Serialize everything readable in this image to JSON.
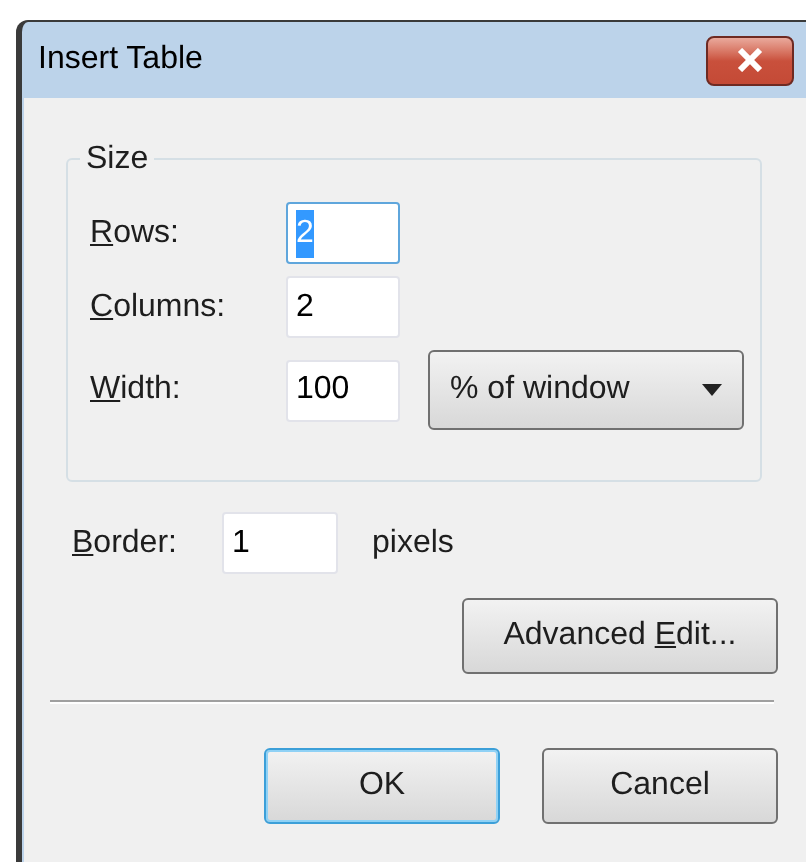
{
  "window": {
    "title": "Insert Table"
  },
  "size_group": {
    "legend": "Size",
    "fields": [
      {
        "mnemonic": "R",
        "after": "ows:",
        "value": "2",
        "selected": true,
        "focused": true
      },
      {
        "mnemonic": "C",
        "after": "olumns:",
        "value": "2",
        "selected": false,
        "focused": false
      },
      {
        "mnemonic": "W",
        "after": "idth:",
        "value": "100",
        "selected": false,
        "focused": false,
        "unit": "% of window"
      }
    ]
  },
  "border": {
    "mnemonic": "B",
    "after": "order:",
    "value": "1",
    "selected": false,
    "focused": false,
    "unit": "pixels"
  },
  "advanced_button": {
    "before": "Advanced ",
    "mnemonic": "E",
    "after": "dit..."
  },
  "buttons": [
    {
      "label": "OK",
      "default": true
    },
    {
      "label": "Cancel",
      "default": false
    }
  ]
}
